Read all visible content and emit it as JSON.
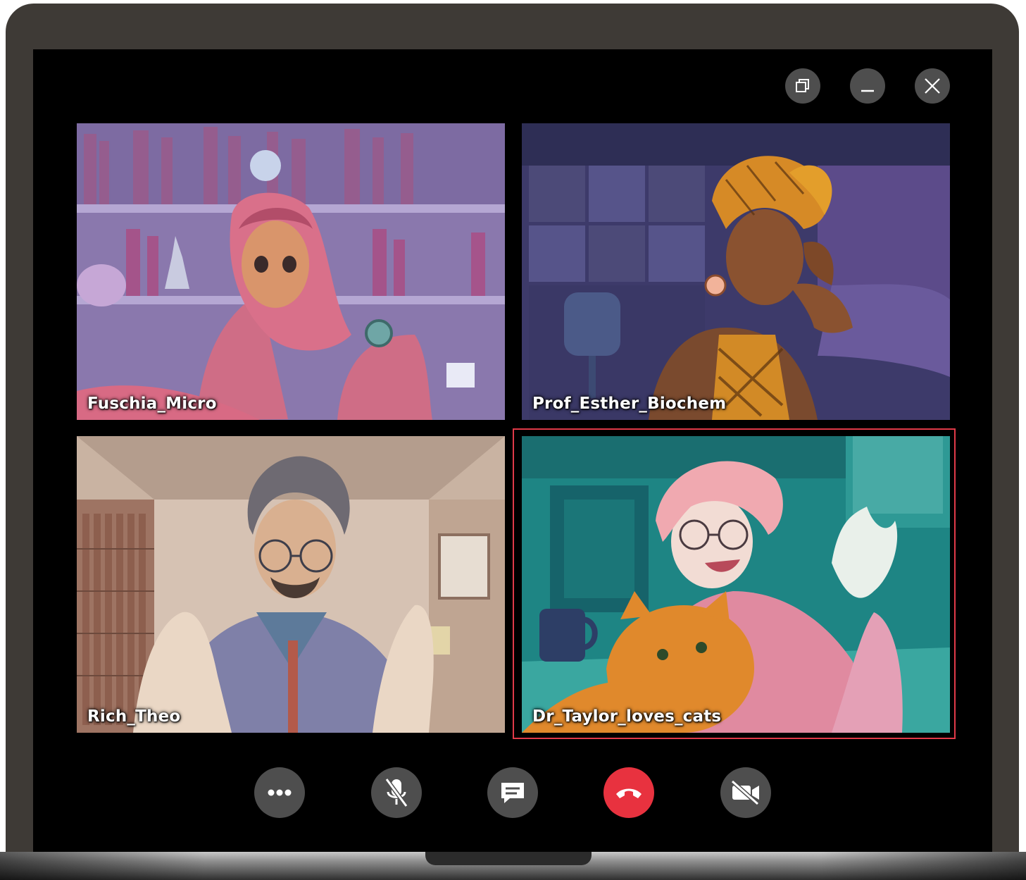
{
  "window_controls": {
    "restore": "restore-icon",
    "minimize": "minimize-icon",
    "close": "close-icon"
  },
  "participants": [
    {
      "name": "Fuschia_Micro",
      "background": "#8a78ad"
    },
    {
      "name": "Prof_Esther_Biochem",
      "background": "#3d3a6a"
    },
    {
      "name": "Rich_Theo",
      "background": "#c9b3a2"
    },
    {
      "name": "Dr_Taylor_loves_cats",
      "background": "#1e8584",
      "active_speaker": true
    }
  ],
  "controls": [
    {
      "icon": "more-options-icon"
    },
    {
      "icon": "microphone-muted-icon"
    },
    {
      "icon": "chat-icon"
    },
    {
      "icon": "end-call-icon"
    },
    {
      "icon": "camera-off-icon"
    }
  ],
  "colors": {
    "laptop_bezel": "#3e3a36",
    "button_gray": "#4e4e4e",
    "hangup_red": "#e8323f",
    "active_border": "#e03a48"
  }
}
